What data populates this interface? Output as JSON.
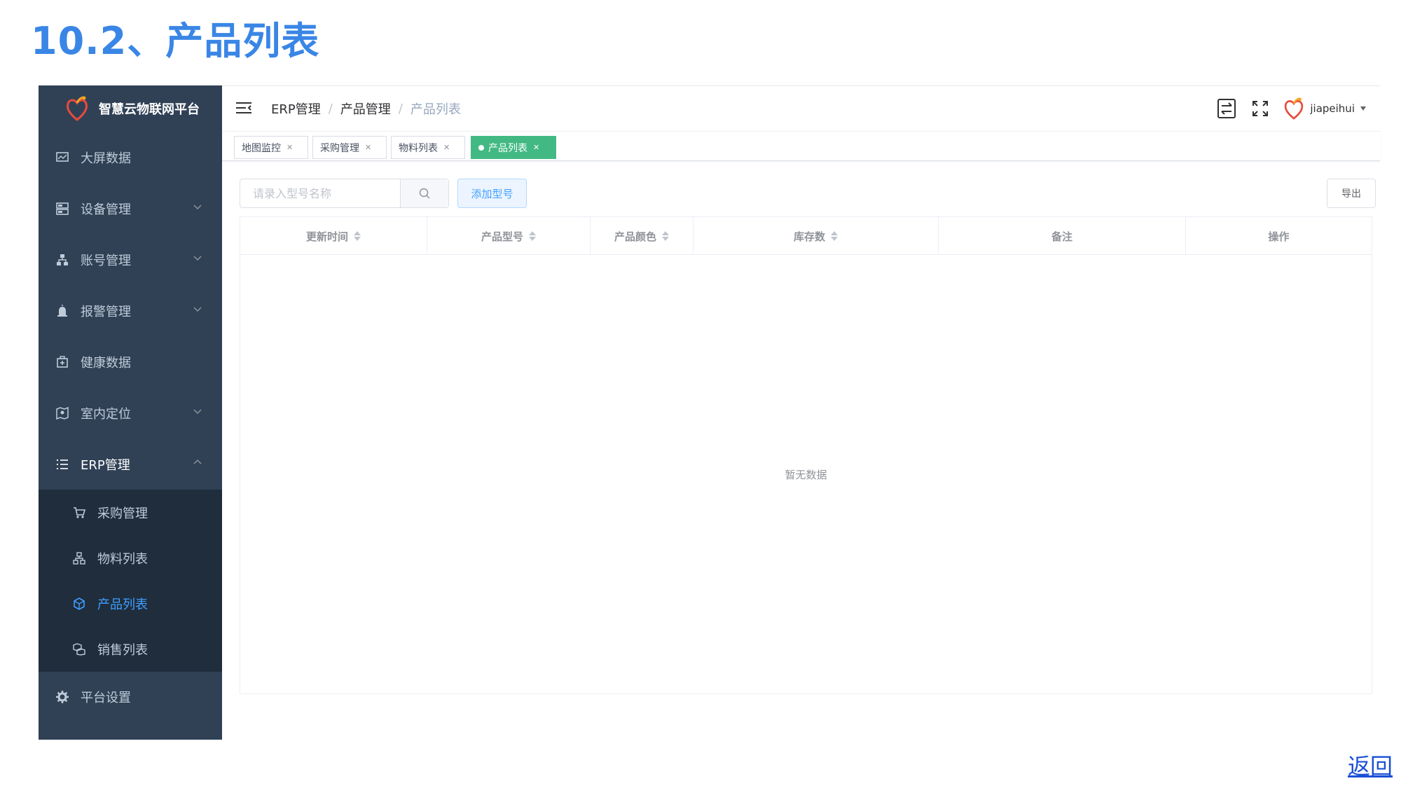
{
  "doc_title": "10.2、产品列表",
  "app": {
    "logo_text": "智慧云物联网平台",
    "menu": [
      {
        "label": "大屏数据",
        "icon": "monitor-icon",
        "has_arrow": false
      },
      {
        "label": "设备管理",
        "icon": "server-icon",
        "has_arrow": true
      },
      {
        "label": "账号管理",
        "icon": "tree-icon",
        "has_arrow": true
      },
      {
        "label": "报警管理",
        "icon": "alarm-icon",
        "has_arrow": true
      },
      {
        "label": "健康数据",
        "icon": "medical-kit-icon",
        "has_arrow": false
      },
      {
        "label": "室内定位",
        "icon": "map-icon",
        "has_arrow": true
      },
      {
        "label": "ERP管理",
        "icon": "list-icon",
        "has_arrow": true,
        "open": true
      },
      {
        "label": "平台设置",
        "icon": "gear-icon",
        "has_arrow": false
      }
    ],
    "submenu": [
      {
        "label": "采购管理",
        "icon": "cart-icon",
        "active": false
      },
      {
        "label": "物料列表",
        "icon": "hierarchy-icon",
        "active": false
      },
      {
        "label": "产品列表",
        "icon": "cube-icon",
        "active": true
      },
      {
        "label": "销售列表",
        "icon": "boxes-icon",
        "active": false
      }
    ],
    "breadcrumb": [
      "ERP管理",
      "产品管理",
      "产品列表"
    ],
    "user": {
      "name": "jiapeihui"
    },
    "tags": [
      {
        "label": "地图监控",
        "active": false
      },
      {
        "label": "采购管理",
        "active": false
      },
      {
        "label": "物料列表",
        "active": false
      },
      {
        "label": "产品列表",
        "active": true
      }
    ],
    "search": {
      "placeholder": "请录入型号名称"
    },
    "add_button": "添加型号",
    "export_button": "导出",
    "table": {
      "columns": [
        {
          "label": "更新时间",
          "sortable": true
        },
        {
          "label": "产品型号",
          "sortable": true
        },
        {
          "label": "产品颜色",
          "sortable": true
        },
        {
          "label": "库存数",
          "sortable": true
        },
        {
          "label": "备注",
          "sortable": false
        },
        {
          "label": "操作",
          "sortable": false
        }
      ],
      "empty_text": "暂无数据"
    }
  },
  "return_link": "返回",
  "colors": {
    "sidebar_bg": "#304156",
    "submenu_bg": "#1f2d3d",
    "active_menu": "#409eff",
    "active_tag": "#42b983",
    "title_blue": "#3a86e6"
  }
}
